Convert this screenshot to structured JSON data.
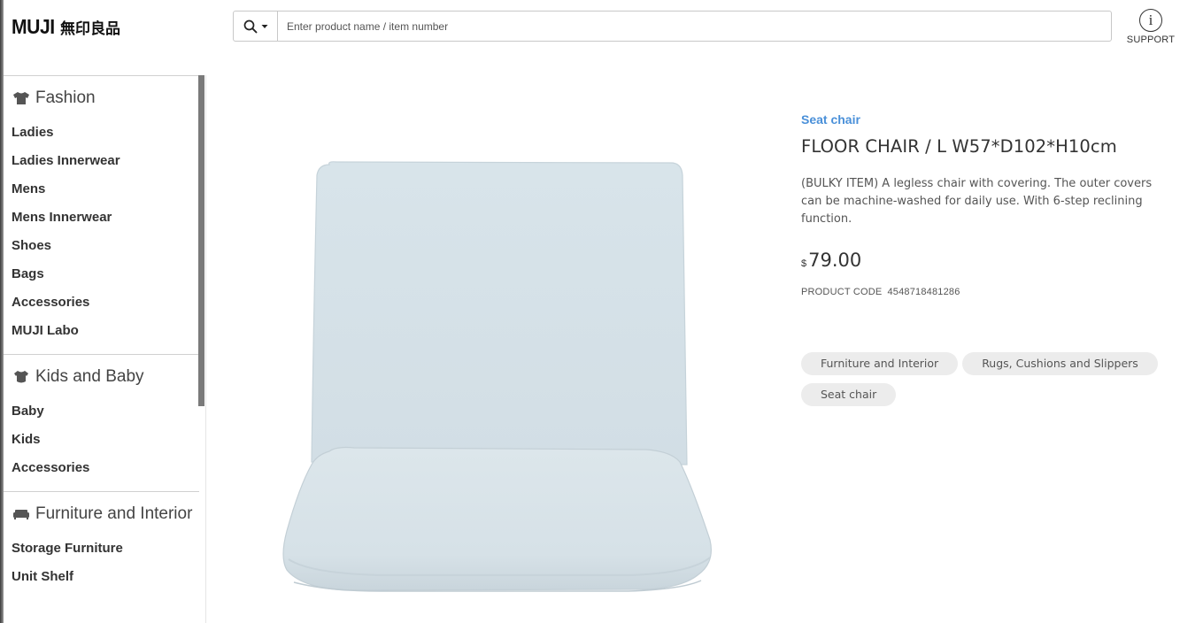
{
  "header": {
    "logo_en": "MUJI",
    "logo_jp": "無印良品",
    "search": {
      "placeholder": "Enter product name / item number",
      "value": ""
    },
    "support_label": "SUPPORT"
  },
  "sidebar": {
    "categories": [
      {
        "title": "Fashion",
        "icon": "tshirt-icon",
        "items": [
          "Ladies",
          "Ladies Innerwear",
          "Mens",
          "Mens Innerwear",
          "Shoes",
          "Bags",
          "Accessories",
          "MUJI Labo"
        ]
      },
      {
        "title": "Kids and Baby",
        "icon": "baby-tshirt-icon",
        "items": [
          "Baby",
          "Kids",
          "Accessories"
        ]
      },
      {
        "title": "Furniture and Interior",
        "icon": "sofa-icon",
        "items": [
          "Storage Furniture",
          "Unit Shelf"
        ]
      }
    ]
  },
  "product": {
    "category_link": "Seat chair",
    "title": "FLOOR CHAIR / L W57*D102*H10cm",
    "description": "(BULKY ITEM) A legless chair with covering. The outer covers can be machine-washed for daily use. With 6-step reclining function.",
    "currency": "$",
    "price": "79.00",
    "code_label": "PRODUCT CODE",
    "code_value": "4548718481286",
    "tags": [
      "Furniture and Interior",
      "Rugs, Cushions and Slippers",
      "Seat chair"
    ],
    "image_color": "#dbe5ea"
  }
}
